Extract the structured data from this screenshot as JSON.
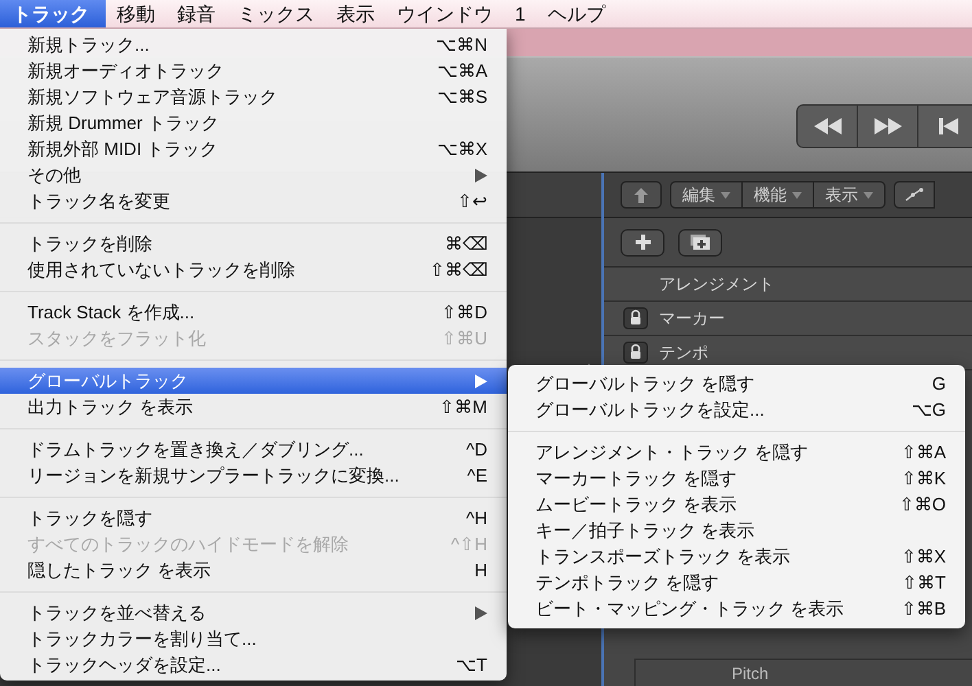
{
  "menubar": [
    {
      "label": "トラック",
      "selected": true
    },
    {
      "label": "移動",
      "selected": false
    },
    {
      "label": "録音",
      "selected": false
    },
    {
      "label": "ミックス",
      "selected": false
    },
    {
      "label": "表示",
      "selected": false
    },
    {
      "label": "ウインドウ",
      "selected": false
    },
    {
      "label": "1",
      "selected": false
    },
    {
      "label": "ヘルプ",
      "selected": false
    }
  ],
  "menu": {
    "items": [
      {
        "kind": "item",
        "label": "新規トラック...",
        "shortcut": "⌥⌘N",
        "disabled": false,
        "selected": false,
        "has_submenu": false
      },
      {
        "kind": "item",
        "label": "新規オーディオトラック",
        "shortcut": "⌥⌘A",
        "disabled": false,
        "selected": false,
        "has_submenu": false
      },
      {
        "kind": "item",
        "label": "新規ソフトウェア音源トラック",
        "shortcut": "⌥⌘S",
        "disabled": false,
        "selected": false,
        "has_submenu": false
      },
      {
        "kind": "item",
        "label": "新規 Drummer トラック",
        "disabled": false,
        "selected": false,
        "has_submenu": false
      },
      {
        "kind": "item",
        "label": "新規外部 MIDI トラック",
        "shortcut": "⌥⌘X",
        "disabled": false,
        "selected": false,
        "has_submenu": false
      },
      {
        "kind": "item",
        "label": "その他",
        "disabled": false,
        "selected": false,
        "has_submenu": true
      },
      {
        "kind": "item",
        "label": "トラック名を変更",
        "shortcut": "⇧↩",
        "disabled": false,
        "selected": false,
        "has_submenu": false
      },
      {
        "kind": "separator"
      },
      {
        "kind": "item",
        "label": "トラックを削除",
        "shortcut": "⌘⌫",
        "disabled": false,
        "selected": false,
        "has_submenu": false
      },
      {
        "kind": "item",
        "label": "使用されていないトラックを削除",
        "shortcut": "⇧⌘⌫",
        "disabled": false,
        "selected": false,
        "has_submenu": false
      },
      {
        "kind": "separator"
      },
      {
        "kind": "item",
        "label": "Track Stack を作成...",
        "shortcut": "⇧⌘D",
        "disabled": false,
        "selected": false,
        "has_submenu": false
      },
      {
        "kind": "item",
        "label": "スタックをフラット化",
        "shortcut": "⇧⌘U",
        "disabled": true,
        "selected": false,
        "has_submenu": false
      },
      {
        "kind": "separator"
      },
      {
        "kind": "item",
        "label": "グローバルトラック",
        "disabled": false,
        "selected": true,
        "has_submenu": true
      },
      {
        "kind": "item",
        "label": "出力トラック を表示",
        "shortcut": "⇧⌘M",
        "disabled": false,
        "selected": false,
        "has_submenu": false
      },
      {
        "kind": "separator"
      },
      {
        "kind": "item",
        "label": "ドラムトラックを置き換え／ダブリング...",
        "shortcut": "^D",
        "disabled": false,
        "selected": false,
        "has_submenu": false
      },
      {
        "kind": "item",
        "label": "リージョンを新規サンプラートラックに変換...",
        "shortcut": "^E",
        "disabled": false,
        "selected": false,
        "has_submenu": false
      },
      {
        "kind": "separator"
      },
      {
        "kind": "item",
        "label": "トラックを隠す",
        "shortcut": "^H",
        "disabled": false,
        "selected": false,
        "has_submenu": false
      },
      {
        "kind": "item",
        "label": "すべてのトラックのハイドモードを解除",
        "shortcut": "^⇧H",
        "disabled": true,
        "selected": false,
        "has_submenu": false
      },
      {
        "kind": "item",
        "label": "隠したトラック を表示",
        "shortcut": "H",
        "disabled": false,
        "selected": false,
        "has_submenu": false
      },
      {
        "kind": "separator"
      },
      {
        "kind": "item",
        "label": "トラックを並べ替える",
        "disabled": false,
        "selected": false,
        "has_submenu": true
      },
      {
        "kind": "item",
        "label": "トラックカラーを割り当て...",
        "disabled": false,
        "selected": false,
        "has_submenu": false
      },
      {
        "kind": "item",
        "label": "トラックヘッダを設定...",
        "shortcut": "⌥T",
        "disabled": false,
        "selected": false,
        "has_submenu": false
      }
    ]
  },
  "submenu": {
    "items": [
      {
        "kind": "item",
        "label": "グローバルトラック を隠す",
        "shortcut": "G"
      },
      {
        "kind": "item",
        "label": "グローバルトラックを設定...",
        "shortcut": "⌥G"
      },
      {
        "kind": "separator"
      },
      {
        "kind": "item",
        "label": "アレンジメント・トラック を隠す",
        "shortcut": "⇧⌘A"
      },
      {
        "kind": "item",
        "label": "マーカートラック を隠す",
        "shortcut": "⇧⌘K"
      },
      {
        "kind": "item",
        "label": "ムービートラック を表示",
        "shortcut": "⇧⌘O"
      },
      {
        "kind": "item",
        "label": "キー／拍子トラック を表示"
      },
      {
        "kind": "item",
        "label": "トランスポーズトラック を表示",
        "shortcut": "⇧⌘X"
      },
      {
        "kind": "item",
        "label": "テンポトラック を隠す",
        "shortcut": "⇧⌘T"
      },
      {
        "kind": "item",
        "label": "ビート・マッピング・トラック を表示",
        "shortcut": "⇧⌘B"
      }
    ]
  },
  "track_toolbar": {
    "buttons": [
      "編集",
      "機能",
      "表示"
    ]
  },
  "global_tracks": [
    {
      "label": "アレンジメント",
      "locked": false
    },
    {
      "label": "マーカー",
      "locked": true
    },
    {
      "label": "テンポ",
      "locked": true
    }
  ],
  "bottom_track": {
    "label": "Pitch"
  }
}
